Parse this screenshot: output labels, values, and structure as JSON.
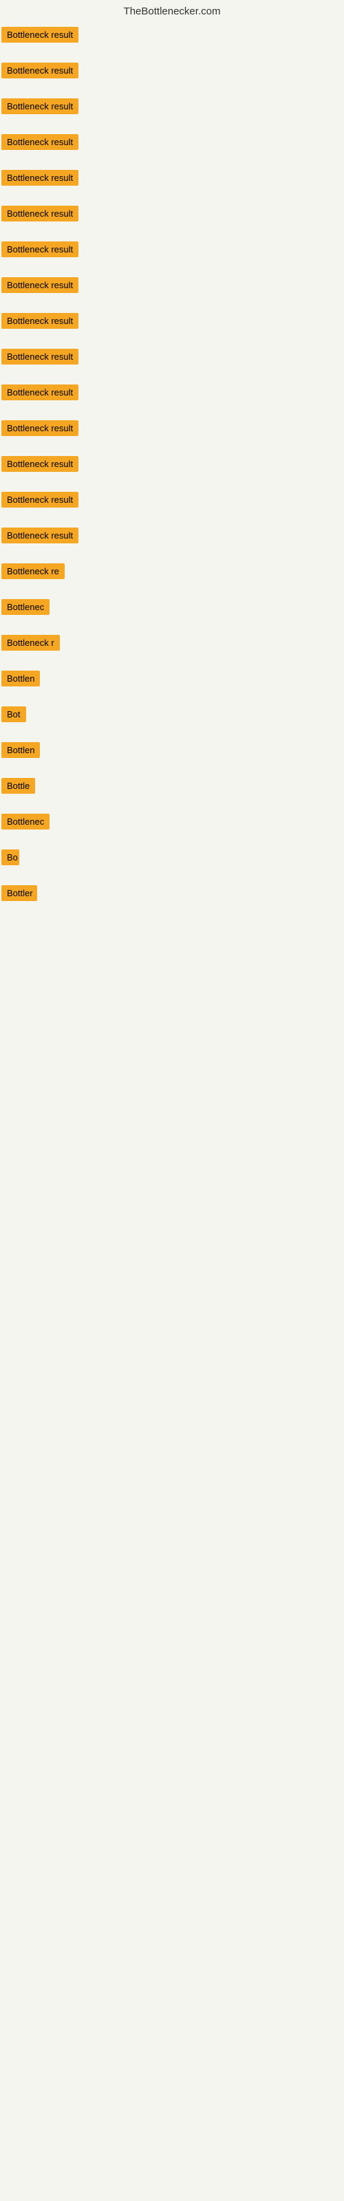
{
  "header": {
    "title": "TheBottlenecker.com"
  },
  "items": [
    {
      "id": 1,
      "label": "Bottleneck result",
      "width": "full"
    },
    {
      "id": 2,
      "label": "Bottleneck result",
      "width": "full"
    },
    {
      "id": 3,
      "label": "Bottleneck result",
      "width": "full"
    },
    {
      "id": 4,
      "label": "Bottleneck result",
      "width": "full"
    },
    {
      "id": 5,
      "label": "Bottleneck result",
      "width": "full"
    },
    {
      "id": 6,
      "label": "Bottleneck result",
      "width": "full"
    },
    {
      "id": 7,
      "label": "Bottleneck result",
      "width": "full"
    },
    {
      "id": 8,
      "label": "Bottleneck result",
      "width": "full"
    },
    {
      "id": 9,
      "label": "Bottleneck result",
      "width": "full"
    },
    {
      "id": 10,
      "label": "Bottleneck result",
      "width": "full"
    },
    {
      "id": 11,
      "label": "Bottleneck result",
      "width": "full"
    },
    {
      "id": 12,
      "label": "Bottleneck result",
      "width": "full"
    },
    {
      "id": 13,
      "label": "Bottleneck result",
      "width": "full"
    },
    {
      "id": 14,
      "label": "Bottleneck result",
      "width": "full"
    },
    {
      "id": 15,
      "label": "Bottleneck result",
      "width": "full"
    },
    {
      "id": 16,
      "label": "Bottleneck re",
      "width": "partial1"
    },
    {
      "id": 17,
      "label": "Bottlenec",
      "width": "partial2"
    },
    {
      "id": 18,
      "label": "Bottleneck r",
      "width": "partial3"
    },
    {
      "id": 19,
      "label": "Bottlen",
      "width": "partial4"
    },
    {
      "id": 20,
      "label": "Bot",
      "width": "partial5"
    },
    {
      "id": 21,
      "label": "Bottlen",
      "width": "partial4"
    },
    {
      "id": 22,
      "label": "Bottle",
      "width": "partial6"
    },
    {
      "id": 23,
      "label": "Bottlenec",
      "width": "partial2"
    },
    {
      "id": 24,
      "label": "Bo",
      "width": "partial7"
    },
    {
      "id": 25,
      "label": "Bottler",
      "width": "partial8"
    }
  ]
}
